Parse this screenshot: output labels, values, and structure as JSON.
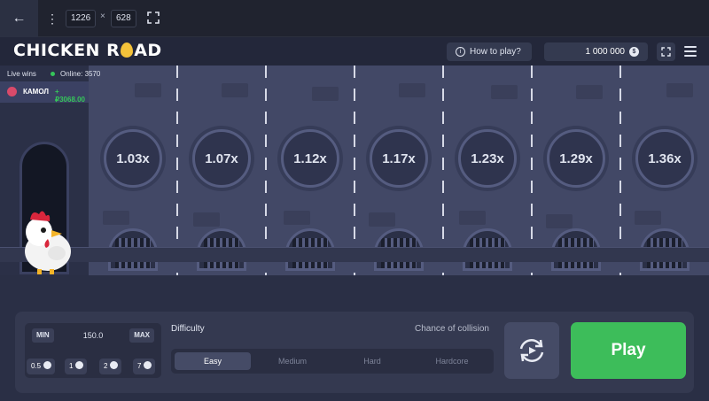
{
  "devbar": {
    "width": "1226",
    "times": "×",
    "height": "628"
  },
  "header": {
    "logo_left": "CHICKEN R",
    "logo_right": "AD",
    "how_to_play": "How to play?",
    "balance": "1 000 000",
    "currency_symbol": "$"
  },
  "live": {
    "label": "Live wins",
    "online": "Online: 3570",
    "user": "КАМОЛ",
    "amount": "+₽3068.00"
  },
  "multipliers": [
    "1.03x",
    "1.07x",
    "1.12x",
    "1.17x",
    "1.23x",
    "1.29x",
    "1.36x"
  ],
  "bet": {
    "min_label": "MIN",
    "value": "150.0",
    "max_label": "MAX",
    "chips": [
      "0.5",
      "1",
      "2",
      "7"
    ]
  },
  "difficulty": {
    "label": "Difficulty",
    "chance_label": "Chance of collision",
    "options": [
      "Easy",
      "Medium",
      "Hard",
      "Hardcore"
    ],
    "selected": "Easy"
  },
  "actions": {
    "play_label": "Play"
  },
  "colors": {
    "accent_green": "#3dbd5a",
    "road": "#424866",
    "panel": "#343950"
  }
}
